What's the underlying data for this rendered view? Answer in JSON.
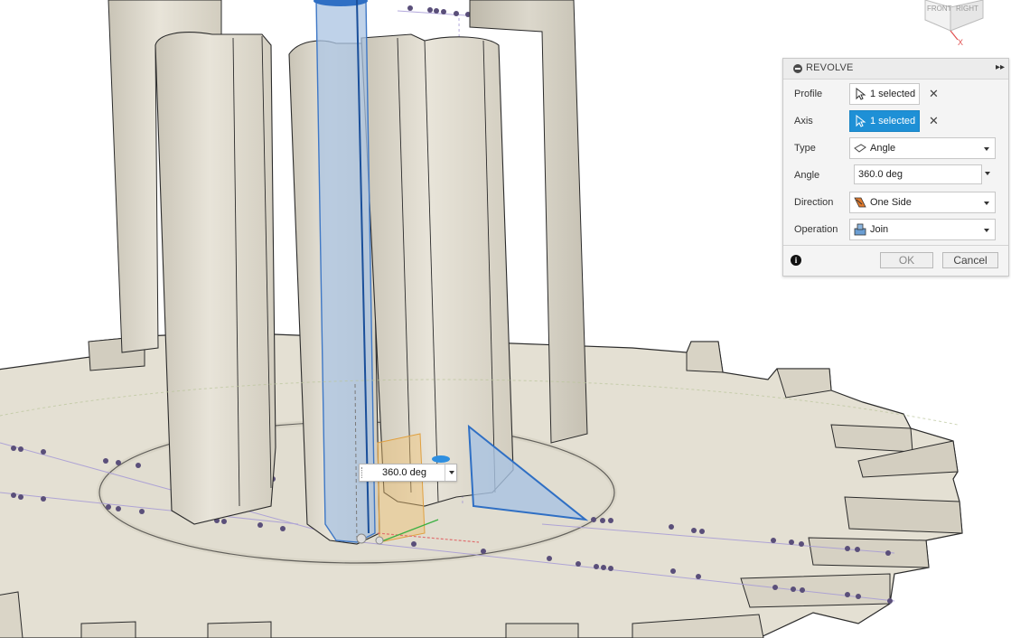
{
  "viewcube": {
    "front_label": "FRONT",
    "right_label": "RIGHT",
    "axis_label": "X",
    "icon": "viewcube-icon"
  },
  "dialog": {
    "title": "REVOLVE",
    "expand_icon": "double-chevron-right-icon",
    "rows": {
      "profile": {
        "label": "Profile",
        "value": "1 selected",
        "icon": "select-arrow-icon"
      },
      "axis": {
        "label": "Axis",
        "value": "1 selected",
        "icon": "select-arrow-icon",
        "active": true
      },
      "type": {
        "label": "Type",
        "value": "Angle",
        "icon": "angle-icon"
      },
      "angle": {
        "label": "Angle",
        "value": "360.0 deg"
      },
      "direction": {
        "label": "Direction",
        "value": "One Side",
        "icon": "one-side-icon"
      },
      "operation": {
        "label": "Operation",
        "value": "Join",
        "icon": "join-icon"
      }
    },
    "ok_label": "OK",
    "cancel_label": "Cancel",
    "info_icon": "info-icon"
  },
  "viewport_input": {
    "value": "360.0 deg"
  },
  "colors": {
    "model_face": "#e6e2d6",
    "edge": "#2b2b2b",
    "selection_blue": "#1e90d6",
    "axis_highlight": "#8fb2dc",
    "profile_fill": "#a9c3e2"
  }
}
